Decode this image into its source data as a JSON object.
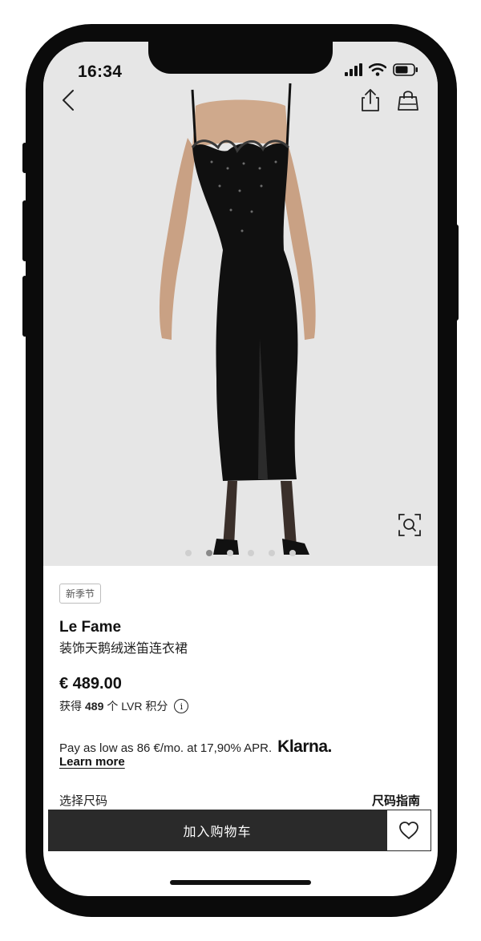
{
  "status_bar": {
    "time": "16:34"
  },
  "gallery": {
    "image_count": 6,
    "active_index": 1
  },
  "product": {
    "badge": "新季节",
    "brand": "Le Fame",
    "name": "装饰天鹅绒迷笛连衣裙",
    "price": "€ 489.00",
    "points_prefix": "获得",
    "points_value": "489",
    "points_suffix": "个 LVR 积分"
  },
  "klarna": {
    "text": "Pay as low as 86 €/mo. at 17,90% APR.",
    "logo": "Klarna.",
    "learn_more": "Learn more"
  },
  "size": {
    "label": "选择尺码",
    "guide": "尺码指南"
  },
  "actions": {
    "add_to_cart": "加入购物车"
  },
  "icons": {
    "back": "chevron-left-icon",
    "share": "share-icon",
    "bag": "shopping-bag-icon",
    "zoom": "visual-search-icon",
    "wishlist": "heart-icon"
  },
  "colors": {
    "cart_button": "#2a2a2a",
    "hero_background": "#e6e6e6"
  }
}
